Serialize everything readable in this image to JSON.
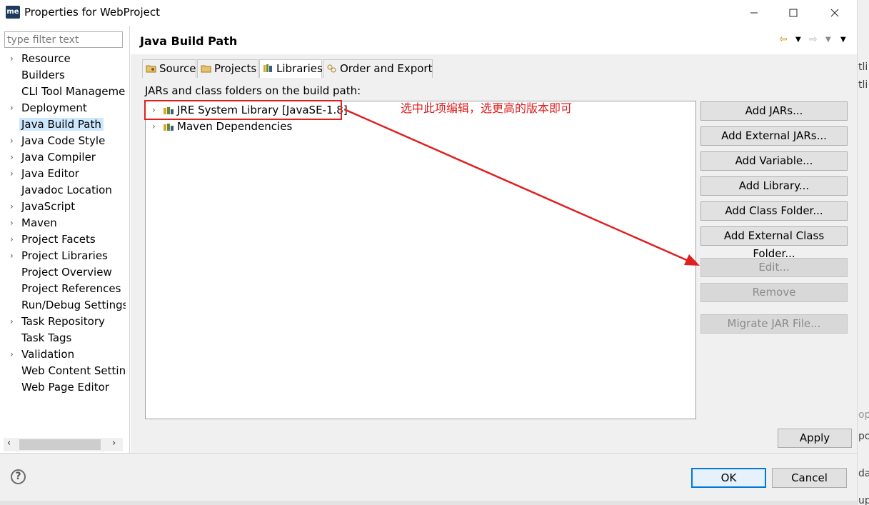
{
  "window": {
    "title": "Properties for WebProject",
    "app_icon_text": "me",
    "controls": [
      "minimize-icon",
      "maximize-icon",
      "close-icon"
    ]
  },
  "filter": {
    "placeholder": "type filter text",
    "value": ""
  },
  "nav": {
    "items": [
      {
        "label": "Resource",
        "expandable": true
      },
      {
        "label": "Builders",
        "expandable": false
      },
      {
        "label": "CLI Tool Manageme",
        "expandable": false
      },
      {
        "label": "Deployment",
        "expandable": true
      },
      {
        "label": "Java Build Path",
        "expandable": false,
        "selected": true
      },
      {
        "label": "Java Code Style",
        "expandable": true
      },
      {
        "label": "Java Compiler",
        "expandable": true
      },
      {
        "label": "Java Editor",
        "expandable": true
      },
      {
        "label": "Javadoc Location",
        "expandable": false
      },
      {
        "label": "JavaScript",
        "expandable": true
      },
      {
        "label": "Maven",
        "expandable": true
      },
      {
        "label": "Project Facets",
        "expandable": true
      },
      {
        "label": "Project Libraries",
        "expandable": true
      },
      {
        "label": "Project Overview",
        "expandable": false
      },
      {
        "label": "Project References",
        "expandable": false
      },
      {
        "label": "Run/Debug Settings",
        "expandable": false
      },
      {
        "label": "Task Repository",
        "expandable": true
      },
      {
        "label": "Task Tags",
        "expandable": false
      },
      {
        "label": "Validation",
        "expandable": true
      },
      {
        "label": "Web Content Settin",
        "expandable": false
      },
      {
        "label": "Web Page Editor",
        "expandable": false
      }
    ]
  },
  "page": {
    "title": "Java Build Path",
    "tabs": [
      {
        "label": "Source",
        "icon": "source-folder-icon"
      },
      {
        "label": "Projects",
        "icon": "project-folder-icon"
      },
      {
        "label": "Libraries",
        "icon": "library-icon",
        "active": true
      },
      {
        "label": "Order and Export",
        "icon": "order-export-icon"
      }
    ],
    "caption": "JARs and class folders on the build path:",
    "libraries": [
      {
        "label": "JRE System Library [JavaSE-1.8]"
      },
      {
        "label": "Maven Dependencies"
      }
    ],
    "buttons": [
      {
        "label": "Add JARs...",
        "enabled": true
      },
      {
        "label": "Add External JARs...",
        "enabled": true
      },
      {
        "label": "Add Variable...",
        "enabled": true
      },
      {
        "label": "Add Library...",
        "enabled": true
      },
      {
        "label": "Add Class Folder...",
        "enabled": true
      },
      {
        "label": "Add External Class Folder...",
        "enabled": true
      },
      {
        "label": "Edit...",
        "enabled": false
      },
      {
        "label": "Remove",
        "enabled": false
      },
      {
        "label": "Migrate JAR File...",
        "enabled": false
      }
    ],
    "apply_label": "Apply"
  },
  "annotation": {
    "text": "选中此项编辑，选更高的版本即可",
    "color": "#e02020"
  },
  "footer": {
    "help_label": "?",
    "ok_label": "OK",
    "cancel_label": "Cancel"
  },
  "background_window_fragments": [
    "tli",
    "tli",
    "ope",
    "po",
    "da",
    "upda"
  ]
}
